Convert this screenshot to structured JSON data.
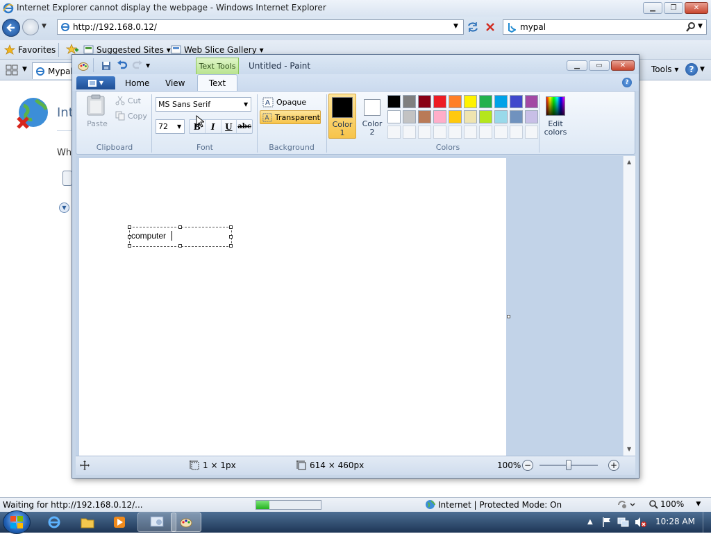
{
  "ie": {
    "title": "Internet Explorer cannot display the webpage - Windows Internet Explorer",
    "address": "http://192.168.0.12/",
    "search_text": "mypal",
    "favorites_label": "Favorites",
    "suggested_sites_label": "Suggested Sites ▾",
    "web_slice_label": "Web Slice Gallery ▾",
    "tab_label": "Mypal",
    "tools_label": "Tools ▾",
    "content_heading_fragment": "Int",
    "content_text_fragment": "Wh",
    "status_text": "Waiting for http://192.168.0.12/...",
    "status_progress": 0.2,
    "zone_text": "Internet | Protected Mode: On",
    "zoom_text": "100%"
  },
  "paint": {
    "title": "Untitled - Paint",
    "context_tab": "Text Tools",
    "tabs": [
      "Home",
      "View",
      "Text"
    ],
    "active_tab": "Text",
    "clipboard": {
      "paste": "Paste",
      "cut": "Cut",
      "copy": "Copy",
      "group": "Clipboard"
    },
    "font": {
      "family": "MS Sans Serif",
      "size": "72",
      "group": "Font",
      "bold": "B",
      "italic": "I",
      "underline": "U",
      "strike": "abc"
    },
    "background": {
      "opaque": "Opaque",
      "transparent": "Transparent",
      "group": "Background"
    },
    "colors": {
      "color1_label": "Color\n1",
      "color1_line1": "Color",
      "color1_line2": "1",
      "color2_line1": "Color",
      "color2_line2": "2",
      "color1": "#000000",
      "color2": "#ffffff",
      "palette_row1": [
        "#000000",
        "#7f7f7f",
        "#880015",
        "#ed1c24",
        "#ff7f27",
        "#fff200",
        "#22b14c",
        "#00a2e8",
        "#3f48cc",
        "#a349a4"
      ],
      "palette_row2": [
        "#ffffff",
        "#c3c3c3",
        "#b97a57",
        "#ffaec9",
        "#ffc90e",
        "#efe4b0",
        "#b5e61d",
        "#99d9ea",
        "#7092be",
        "#c8bfe7"
      ],
      "edit_line1": "Edit",
      "edit_line2": "colors",
      "group": "Colors"
    },
    "canvas_text": "computer",
    "status": {
      "cursor_size": "1 × 1px",
      "canvas_size": "614 × 460px",
      "zoom": "100%",
      "zoom_level": 0.5
    }
  },
  "taskbar": {
    "clock": "10:28 AM"
  }
}
